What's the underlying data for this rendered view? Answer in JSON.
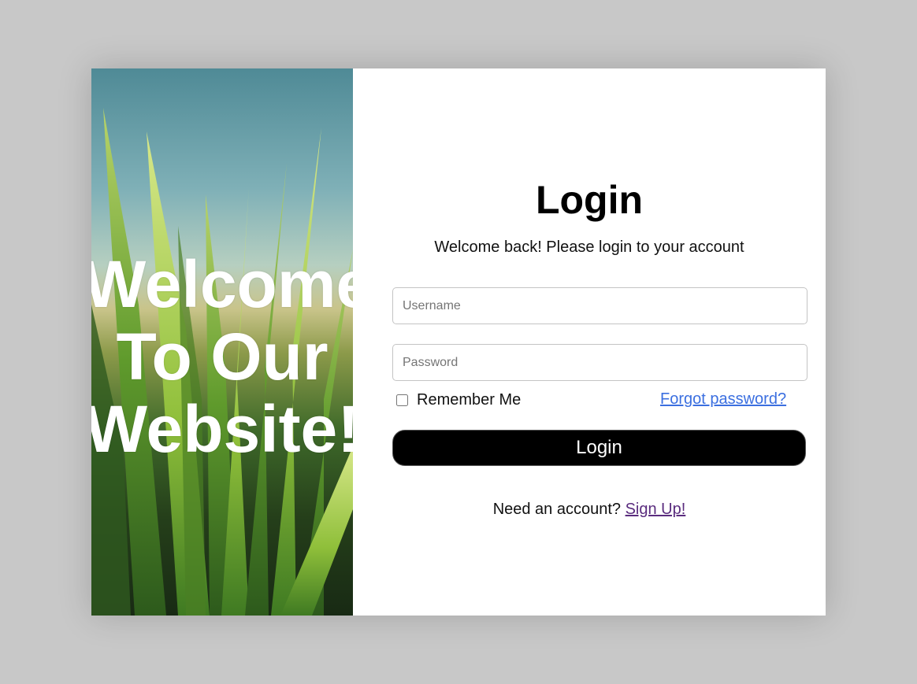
{
  "hero": {
    "line1": "Welcome",
    "line2": "To Our",
    "line3": "Website!"
  },
  "login": {
    "title": "Login",
    "subtitle": "Welcome back! Please login to your account",
    "username_placeholder": "Username",
    "password_placeholder": "Password",
    "remember_label": "Remember Me",
    "forgot_label": "Forgot password?",
    "button_label": "Login",
    "signup_prompt": "Need an account?",
    "signup_link": "Sign Up!"
  }
}
